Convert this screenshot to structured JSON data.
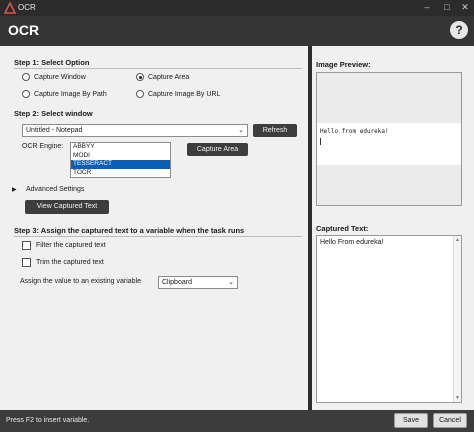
{
  "window": {
    "title": "OCR"
  },
  "header": {
    "title": "OCR",
    "help": "?"
  },
  "step1": {
    "title": "Step 1: Select Option",
    "options": [
      "Capture Window",
      "Capture Area",
      "Capture Image By Path",
      "Capture Image By URL"
    ],
    "selected": "Capture Area"
  },
  "step2": {
    "title": "Step 2: Select window",
    "window_value": "Untitled - Notepad",
    "refresh_label": "Refresh",
    "engine_label": "OCR Engine:",
    "engines": [
      "ABBYY",
      "MODI",
      "TESSERACT",
      "TOCR"
    ],
    "selected_engine": "TESSERACT",
    "capture_area_label": "Capture Area",
    "advanced_label": "Advanced Settings",
    "view_captured_label": "View Captured Text"
  },
  "step3": {
    "title": "Step 3: Assign the captured text to a variable when the task runs",
    "filter_label": "Filter the captured text",
    "trim_label": "Trim the captured text",
    "assign_label": "Assign the value to an existing variable",
    "variable_value": "Clipboard"
  },
  "right": {
    "preview_title": "Image Preview:",
    "preview_text": "Hello from edureka!",
    "captured_title": "Captured Text:",
    "captured_text": "Hello From edureka!"
  },
  "footer": {
    "hint": "Press F2 to insert variable.",
    "save_label": "Save",
    "cancel_label": "Cancel"
  },
  "colors": {
    "accent": "#0a5fb4",
    "dark_button": "#3d3d3d",
    "chrome": "#3c3c3c"
  }
}
